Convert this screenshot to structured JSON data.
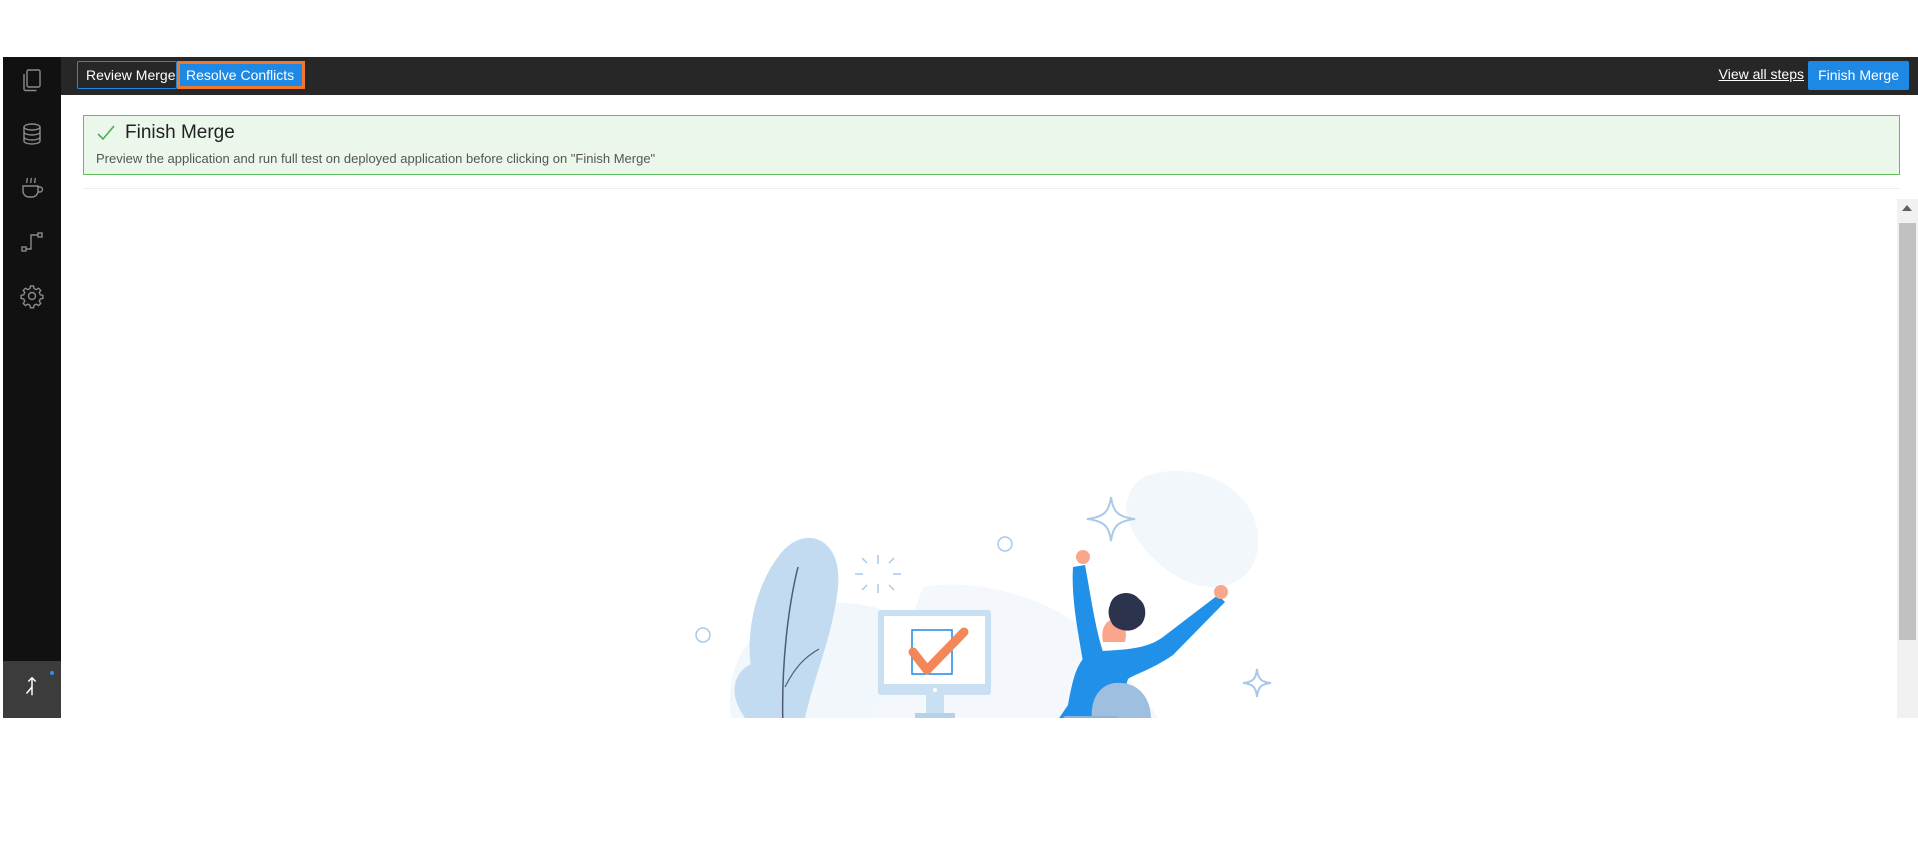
{
  "sidebar": {
    "items": [
      {
        "icon": "files-icon"
      },
      {
        "icon": "database-icon"
      },
      {
        "icon": "coffee-cup-icon"
      },
      {
        "icon": "route-icon"
      },
      {
        "icon": "gear-icon"
      }
    ],
    "active": {
      "icon": "merge-icon"
    }
  },
  "toolbar": {
    "steps": [
      {
        "label": "Review Merge"
      },
      {
        "label": "Resolve Conflicts"
      }
    ],
    "view_all_label": "View all steps",
    "finish_label": "Finish Merge"
  },
  "banner": {
    "title": "Finish Merge",
    "description": "Preview the application and run full test on deployed application before clicking on \"Finish Merge\""
  },
  "colors": {
    "accent": "#1e88e5",
    "highlight": "#f0782a",
    "success": "#5cc05c",
    "sidebar": "#111111",
    "topbar": "#272727"
  }
}
